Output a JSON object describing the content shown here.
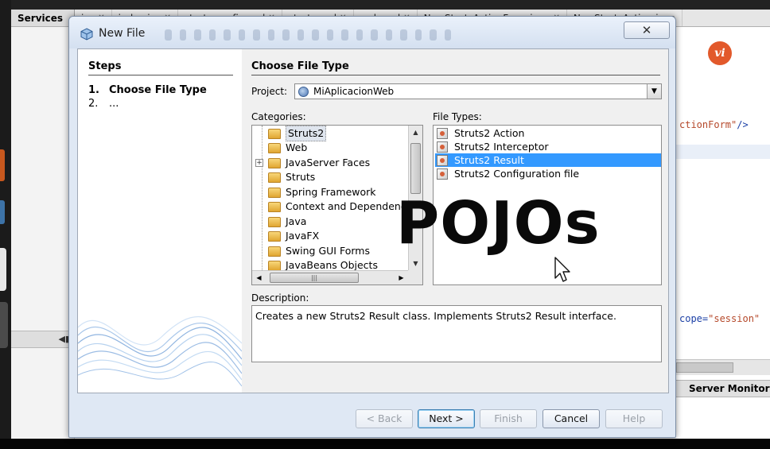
{
  "ide": {
    "services_tab": "Services",
    "file_tabs": [
      "jsp",
      "index.jsp",
      "struts-config.xml",
      "struts.xml",
      "web.xml",
      "NewStrutsActionForm.java",
      "NewStrutsAction.java"
    ],
    "code_line1_attr": "ctionForm\"",
    "code_line1_close": "/>",
    "code_line2_attr": "cope=",
    "code_line2_value": "\"session\"",
    "server_monitor_label": "Server Monitor",
    "logo_text": "vi"
  },
  "dialog": {
    "title": "New File",
    "close_symbol": "✕",
    "steps": {
      "heading": "Steps",
      "items": [
        {
          "num": "1.",
          "label": "Choose File Type"
        },
        {
          "num": "2.",
          "label": "..."
        }
      ]
    },
    "main": {
      "heading": "Choose File Type",
      "project_label": "Project:",
      "project_value": "MiAplicacionWeb",
      "categories_label": "Categories:",
      "file_types_label": "File Types:",
      "categories": [
        {
          "label": "Struts2",
          "selected": true
        },
        {
          "label": "Web"
        },
        {
          "label": "JavaServer Faces",
          "expandable": true
        },
        {
          "label": "Struts"
        },
        {
          "label": "Spring Framework"
        },
        {
          "label": "Context and Dependency"
        },
        {
          "label": "Java"
        },
        {
          "label": "JavaFX"
        },
        {
          "label": "Swing GUI Forms"
        },
        {
          "label": "JavaBeans Objects"
        }
      ],
      "file_types": [
        {
          "label": "Struts2 Action"
        },
        {
          "label": "Struts2 Interceptor"
        },
        {
          "label": "Struts2 Result",
          "selected": true
        },
        {
          "label": "Struts2 Configuration file"
        }
      ],
      "description_label": "Description:",
      "description_text": "Creates a new Struts2 Result class. Implements Struts2 Result interface."
    },
    "buttons": {
      "back": "< Back",
      "next": "Next >",
      "finish": "Finish",
      "cancel": "Cancel",
      "help": "Help"
    }
  },
  "overlay": {
    "caption": "POJOs"
  }
}
